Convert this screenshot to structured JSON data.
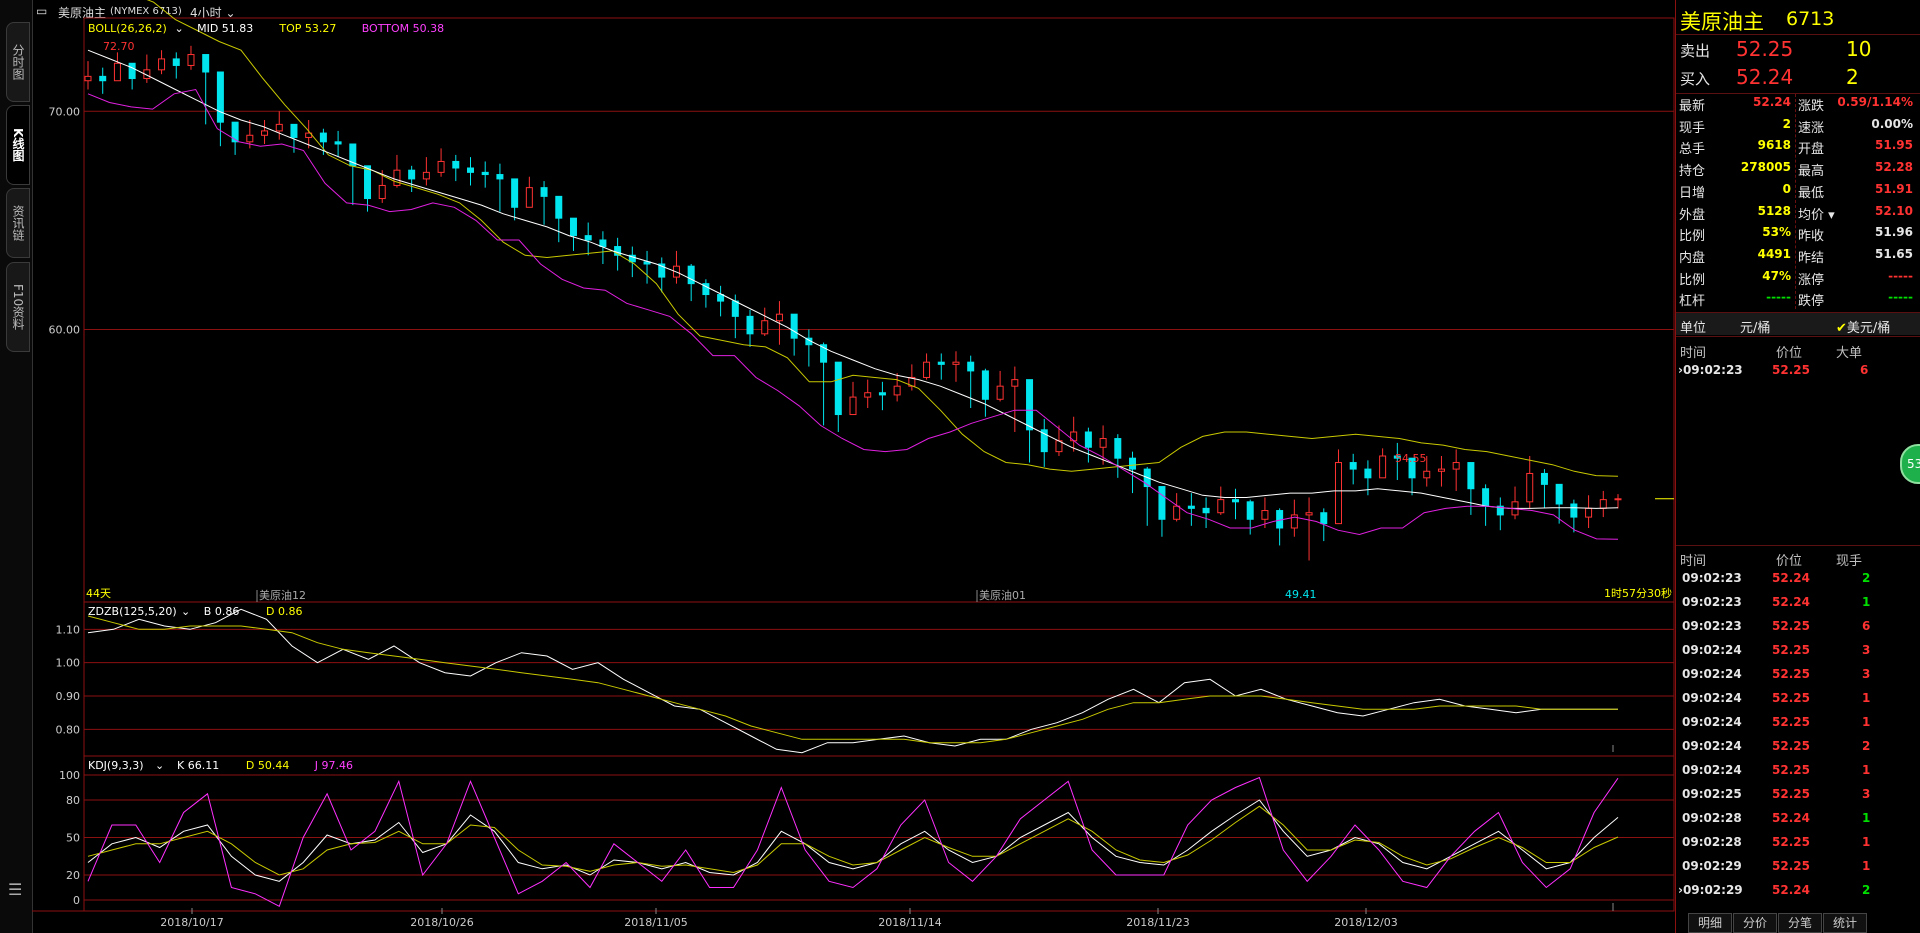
{
  "title_bar": {
    "symbol": "美原油主",
    "code": "(NYMEX 6713)",
    "period": "4小时"
  },
  "side_tabs": [
    "分时图",
    "K线图",
    "资讯链",
    "F10资料"
  ],
  "colors": {
    "bg": "#000000",
    "up": "#ff3232",
    "down": "#00e5ee",
    "mid": "#ffffff",
    "top": "#c8c800",
    "bottom": "#e020e0",
    "grid": "#8b1010"
  },
  "chart_data": [
    {
      "type": "candlestick",
      "indicator": "BOLL(26,26,2)",
      "legend": [
        {
          "label": "BOLL(26,26,2)",
          "color": "#ffff00"
        },
        {
          "label": "MID 51.83",
          "color": "#ffffff"
        },
        {
          "label": "TOP 53.27",
          "color": "#ffff00"
        },
        {
          "label": "BOTTOM 50.38",
          "color": "#ff40ff"
        }
      ],
      "ylim": [
        47.6,
        74.0
      ],
      "yticks": [
        "70.00",
        "60.00"
      ],
      "annotations": {
        "high": "72.70",
        "mid_high": "54.55",
        "low": "49.41",
        "days": "44天",
        "contract1": "美原油12",
        "contract2": "美原油01",
        "countdown": "1时57分30秒"
      },
      "close": [
        71.6,
        71.4,
        72.2,
        71.5,
        71.9,
        72.4,
        72.1,
        72.6,
        71.8,
        69.5,
        68.6,
        68.9,
        69.1,
        69.4,
        68.8,
        69.0,
        68.6,
        68.5,
        67.5,
        66.0,
        66.6,
        67.3,
        66.9,
        67.2,
        67.7,
        67.4,
        67.2,
        67.1,
        66.9,
        65.6,
        66.5,
        66.1,
        65.1,
        64.3,
        64.1,
        63.8,
        63.4,
        63.1,
        63.0,
        62.4,
        62.9,
        62.1,
        61.6,
        61.3,
        60.6,
        59.8,
        60.4,
        60.7,
        59.6,
        59.3,
        58.5,
        56.1,
        56.9,
        57.1,
        57.0,
        57.4,
        57.8,
        58.5,
        58.4,
        58.5,
        58.1,
        56.8,
        57.4,
        57.7,
        55.4,
        54.4,
        54.9,
        55.3,
        54.6,
        55.0,
        54.1,
        53.6,
        52.8,
        51.3,
        51.9,
        51.8,
        51.6,
        52.2,
        52.1,
        51.3,
        51.7,
        50.9,
        51.5,
        51.6,
        51.1,
        53.9,
        53.6,
        53.2,
        54.2,
        54.1,
        53.2,
        53.5,
        53.6,
        53.9,
        52.7,
        51.9,
        51.5,
        52.1,
        53.4,
        52.9,
        52.0,
        51.4,
        51.8,
        52.2,
        52.24
      ],
      "high": [
        72.3,
        72.0,
        72.7,
        72.2,
        72.6,
        72.8,
        72.7,
        73.0,
        72.4,
        70.2,
        69.3,
        69.6,
        69.6,
        70.0,
        69.4,
        69.6,
        69.2,
        69.1,
        68.3,
        67.2,
        67.3,
        68.0,
        67.5,
        67.9,
        68.3,
        68.0,
        67.9,
        67.7,
        67.6,
        66.9,
        67.0,
        66.8,
        66.1,
        65.0,
        64.9,
        64.5,
        64.2,
        63.8,
        63.6,
        63.3,
        63.6,
        63.0,
        62.3,
        62.0,
        61.6,
        60.9,
        61.0,
        61.3,
        60.6,
        60.0,
        59.4,
        57.6,
        57.6,
        57.7,
        57.6,
        58.0,
        58.4,
        58.9,
        58.9,
        59.0,
        58.8,
        58.2,
        58.1,
        58.3,
        56.9,
        55.9,
        55.6,
        56.0,
        55.5,
        55.6,
        55.2,
        54.4,
        53.7,
        52.5,
        52.5,
        52.5,
        52.3,
        52.8,
        52.7,
        52.2,
        52.3,
        51.8,
        52.2,
        52.3,
        51.8,
        54.5,
        54.3,
        54.0,
        54.55,
        54.8,
        54.0,
        54.2,
        54.2,
        54.5,
        53.9,
        52.9,
        52.3,
        52.8,
        54.2,
        53.6,
        52.7,
        52.2,
        52.4,
        52.6,
        52.45
      ],
      "low": [
        71.0,
        70.8,
        71.5,
        71.0,
        71.3,
        71.7,
        71.5,
        71.9,
        69.4,
        68.4,
        68.0,
        68.3,
        68.5,
        68.7,
        68.1,
        68.3,
        68.0,
        67.9,
        65.7,
        65.4,
        65.8,
        66.5,
        66.3,
        66.6,
        67.0,
        66.8,
        66.6,
        66.5,
        65.4,
        65.0,
        65.7,
        64.8,
        64.0,
        63.6,
        63.4,
        63.0,
        62.7,
        62.4,
        62.1,
        61.7,
        62.1,
        61.3,
        61.0,
        60.6,
        59.6,
        59.2,
        59.7,
        59.3,
        58.8,
        58.3,
        55.6,
        55.3,
        56.1,
        56.4,
        56.3,
        56.7,
        57.2,
        57.7,
        57.7,
        57.6,
        56.4,
        56.0,
        56.7,
        55.3,
        53.9,
        53.7,
        54.2,
        54.4,
        53.9,
        53.8,
        53.2,
        52.5,
        51.0,
        50.5,
        51.2,
        51.0,
        50.9,
        51.5,
        51.3,
        50.6,
        50.9,
        50.1,
        50.5,
        49.41,
        50.3,
        51.3,
        52.9,
        52.4,
        53.4,
        53.1,
        52.4,
        52.8,
        52.8,
        52.6,
        51.5,
        51.0,
        50.8,
        51.3,
        51.8,
        51.8,
        51.1,
        50.7,
        50.9,
        51.4,
        51.8
      ],
      "mid": [
        72.8,
        72.4,
        72.0,
        71.5,
        71.0,
        70.5,
        70.0,
        69.6,
        69.3,
        68.9,
        68.5,
        68.1,
        67.7,
        67.3,
        66.9,
        66.6,
        66.3,
        66.0,
        65.7,
        65.3,
        65.0,
        64.7,
        64.3,
        64.0,
        63.6,
        63.3,
        63.0,
        62.6,
        62.1,
        61.6,
        61.1,
        60.6,
        60.1,
        59.5,
        59.0,
        58.6,
        58.2,
        57.9,
        57.7,
        57.4,
        57.0,
        56.6,
        56.1,
        55.6,
        55.1,
        54.6,
        54.2,
        53.8,
        53.4,
        53.0,
        52.7,
        52.4,
        52.3,
        52.3,
        52.4,
        52.5,
        52.5,
        52.6,
        52.6,
        52.7,
        52.6,
        52.5,
        52.3,
        52.1,
        51.9,
        51.8,
        51.8,
        51.83,
        51.83,
        51.8,
        51.83
      ],
      "top": [
        76.0,
        75.8,
        75.4,
        75.0,
        74.2,
        73.7,
        73.2,
        72.8,
        71.5,
        70.3,
        69.2,
        68.0,
        67.5,
        67.3,
        66.8,
        66.5,
        66.2,
        65.8,
        65.0,
        64.0,
        63.4,
        63.3,
        63.4,
        63.5,
        63.6,
        63.0,
        62.1,
        60.7,
        59.7,
        59.5,
        59.3,
        59.2,
        58.7,
        57.6,
        57.6,
        57.9,
        57.8,
        57.7,
        57.3,
        56.3,
        55.2,
        54.4,
        53.9,
        53.8,
        53.6,
        53.5,
        53.6,
        53.7,
        53.8,
        53.9,
        54.6,
        55.1,
        55.3,
        55.3,
        55.2,
        55.1,
        55.0,
        55.1,
        55.2,
        55.1,
        55.0,
        54.8,
        54.7,
        54.5,
        54.4,
        54.2,
        54.0,
        53.8,
        53.5,
        53.3,
        53.27
      ],
      "bottom": [
        70.8,
        70.4,
        70.2,
        70.1,
        70.8,
        71.0,
        69.2,
        68.6,
        68.4,
        68.5,
        68.2,
        66.7,
        65.8,
        65.7,
        65.4,
        65.5,
        65.8,
        65.6,
        65.0,
        64.1,
        64.1,
        63.0,
        62.3,
        61.9,
        61.8,
        61.2,
        60.9,
        60.6,
        59.8,
        58.8,
        58.8,
        57.8,
        57.2,
        56.5,
        55.6,
        55.0,
        54.5,
        54.4,
        54.5,
        55.0,
        55.3,
        55.7,
        56.0,
        56.3,
        56.3,
        55.5,
        54.7,
        54.2,
        53.6,
        53.0,
        52.3,
        51.6,
        51.3,
        50.9,
        50.9,
        51.2,
        51.4,
        51.2,
        50.8,
        50.6,
        50.9,
        50.9,
        51.6,
        51.8,
        51.9,
        51.9,
        51.8,
        51.7,
        51.5,
        50.8,
        50.4,
        50.38
      ]
    },
    {
      "type": "line",
      "indicator": "ZDZB(125,5,20)",
      "legend": [
        {
          "label": "ZDZB(125,5,20)",
          "color": "#ffffff"
        },
        {
          "label": "B 0.86",
          "color": "#ffffff"
        },
        {
          "label": "D 0.86",
          "color": "#ffff00"
        }
      ],
      "ylim": [
        0.72,
        1.17
      ],
      "yticks": [
        "1.10",
        "1.00",
        "0.90",
        "0.80"
      ],
      "series": [
        {
          "name": "B",
          "values": [
            1.09,
            1.1,
            1.13,
            1.11,
            1.1,
            1.12,
            1.16,
            1.13,
            1.05,
            1.0,
            1.04,
            1.01,
            1.05,
            1.0,
            0.97,
            0.96,
            1.0,
            1.03,
            1.02,
            0.98,
            1.0,
            0.95,
            0.91,
            0.87,
            0.86,
            0.82,
            0.78,
            0.74,
            0.73,
            0.76,
            0.76,
            0.77,
            0.78,
            0.76,
            0.75,
            0.77,
            0.77,
            0.8,
            0.82,
            0.85,
            0.89,
            0.92,
            0.88,
            0.94,
            0.95,
            0.9,
            0.92,
            0.89,
            0.87,
            0.85,
            0.84,
            0.86,
            0.88,
            0.89,
            0.87,
            0.86,
            0.85,
            0.86,
            0.86,
            0.86,
            0.86
          ]
        },
        {
          "name": "D",
          "values": [
            1.14,
            1.12,
            1.1,
            1.1,
            1.11,
            1.11,
            1.11,
            1.1,
            1.09,
            1.06,
            1.04,
            1.03,
            1.02,
            1.01,
            1.0,
            0.99,
            0.98,
            0.97,
            0.96,
            0.95,
            0.94,
            0.92,
            0.9,
            0.88,
            0.86,
            0.84,
            0.81,
            0.79,
            0.77,
            0.77,
            0.77,
            0.77,
            0.77,
            0.76,
            0.76,
            0.76,
            0.77,
            0.79,
            0.81,
            0.83,
            0.86,
            0.88,
            0.88,
            0.89,
            0.9,
            0.9,
            0.9,
            0.89,
            0.88,
            0.87,
            0.86,
            0.86,
            0.86,
            0.87,
            0.87,
            0.87,
            0.87,
            0.86,
            0.86,
            0.86,
            0.86
          ]
        }
      ]
    },
    {
      "type": "line",
      "indicator": "KDJ(9,3,3)",
      "legend": [
        {
          "label": "KDJ(9,3,3)",
          "color": "#ffffff"
        },
        {
          "label": "K 66.11",
          "color": "#ffffff"
        },
        {
          "label": "D 50.44",
          "color": "#ffff00"
        },
        {
          "label": "J 97.46",
          "color": "#ff40ff"
        }
      ],
      "ylim": [
        -8,
        112
      ],
      "yticks": [
        "100",
        "80",
        "50",
        "20",
        "0"
      ],
      "series": [
        {
          "name": "K",
          "values": [
            30,
            45,
            50,
            42,
            55,
            60,
            35,
            20,
            15,
            30,
            52,
            45,
            48,
            62,
            38,
            45,
            68,
            55,
            30,
            25,
            28,
            20,
            32,
            30,
            25,
            30,
            22,
            20,
            30,
            55,
            45,
            30,
            25,
            30,
            45,
            55,
            40,
            30,
            35,
            50,
            60,
            70,
            50,
            35,
            30,
            28,
            40,
            55,
            68,
            80,
            55,
            35,
            40,
            50,
            45,
            30,
            25,
            35,
            45,
            55,
            40,
            25,
            30,
            50,
            66.11
          ]
        },
        {
          "name": "D",
          "values": [
            35,
            40,
            45,
            45,
            50,
            55,
            45,
            30,
            20,
            25,
            40,
            45,
            46,
            55,
            45,
            45,
            60,
            58,
            40,
            28,
            27,
            23,
            28,
            30,
            27,
            28,
            25,
            22,
            28,
            45,
            45,
            35,
            28,
            30,
            40,
            50,
            42,
            35,
            35,
            45,
            55,
            65,
            55,
            40,
            32,
            30,
            36,
            48,
            62,
            75,
            60,
            40,
            40,
            48,
            46,
            35,
            28,
            33,
            42,
            50,
            42,
            30,
            30,
            42,
            50.44
          ]
        },
        {
          "name": "J",
          "values": [
            15,
            60,
            60,
            30,
            70,
            85,
            10,
            5,
            -5,
            50,
            85,
            40,
            55,
            95,
            20,
            45,
            95,
            50,
            5,
            15,
            30,
            10,
            45,
            30,
            15,
            40,
            10,
            10,
            40,
            90,
            40,
            15,
            10,
            25,
            60,
            80,
            30,
            15,
            35,
            65,
            80,
            95,
            40,
            20,
            20,
            20,
            60,
            80,
            90,
            98,
            40,
            15,
            35,
            60,
            40,
            15,
            10,
            35,
            55,
            70,
            30,
            10,
            25,
            70,
            97.46
          ]
        }
      ],
      "x_tick_labels": [
        "2018/10/17",
        "2018/10/26",
        "2018/11/05",
        "2018/11/14",
        "2018/11/23",
        "2018/12/03"
      ]
    }
  ],
  "quote_panel": {
    "name": "美原油主",
    "code": "6713",
    "sell_label": "卖出",
    "sell_price": "52.25",
    "sell_vol": "10",
    "buy_label": "买入",
    "buy_price": "52.24",
    "buy_vol": "2",
    "stats": [
      [
        "最新",
        "52.24",
        "涨跌",
        "0.59/1.14%"
      ],
      [
        "现手",
        "2",
        "速涨",
        "0.00%"
      ],
      [
        "总手",
        "9618",
        "开盘",
        "51.95"
      ],
      [
        "持仓",
        "278005",
        "最高",
        "52.28"
      ],
      [
        "日增",
        "0",
        "最低",
        "51.91"
      ],
      [
        "外盘",
        "5128",
        "均价",
        "52.10"
      ],
      [
        "比例",
        "53%",
        "昨收",
        "51.96"
      ],
      [
        "内盘",
        "4491",
        "昨结",
        "51.65"
      ],
      [
        "比例",
        "47%",
        "涨停",
        "-----"
      ],
      [
        "杠杆",
        "-----",
        "跌停",
        "-----"
      ]
    ],
    "unit_label": "单位",
    "unit_cny": "元/桶",
    "unit_usd": "美元/桶",
    "big_header": [
      "时间",
      "价位",
      "大单"
    ],
    "big_row": [
      "09:02:23",
      "52.25",
      "6"
    ],
    "tick_header": [
      "时间",
      "价位",
      "现手"
    ],
    "ticks": [
      [
        "09:02:23",
        "52.24",
        "2"
      ],
      [
        "09:02:23",
        "52.24",
        "1"
      ],
      [
        "09:02:23",
        "52.25",
        "6"
      ],
      [
        "09:02:24",
        "52.25",
        "3"
      ],
      [
        "09:02:24",
        "52.25",
        "3"
      ],
      [
        "09:02:24",
        "52.25",
        "1"
      ],
      [
        "09:02:24",
        "52.25",
        "1"
      ],
      [
        "09:02:24",
        "52.25",
        "2"
      ],
      [
        "09:02:24",
        "52.25",
        "1"
      ],
      [
        "09:02:25",
        "52.25",
        "3"
      ],
      [
        "09:02:28",
        "52.24",
        "1"
      ],
      [
        "09:02:28",
        "52.25",
        "1"
      ],
      [
        "09:02:29",
        "52.25",
        "1"
      ],
      [
        "09:02:29",
        "52.24",
        "2"
      ]
    ],
    "bottom_tabs": [
      "明细",
      "分价",
      "分笔",
      "统计"
    ],
    "circle_badge": "53"
  }
}
